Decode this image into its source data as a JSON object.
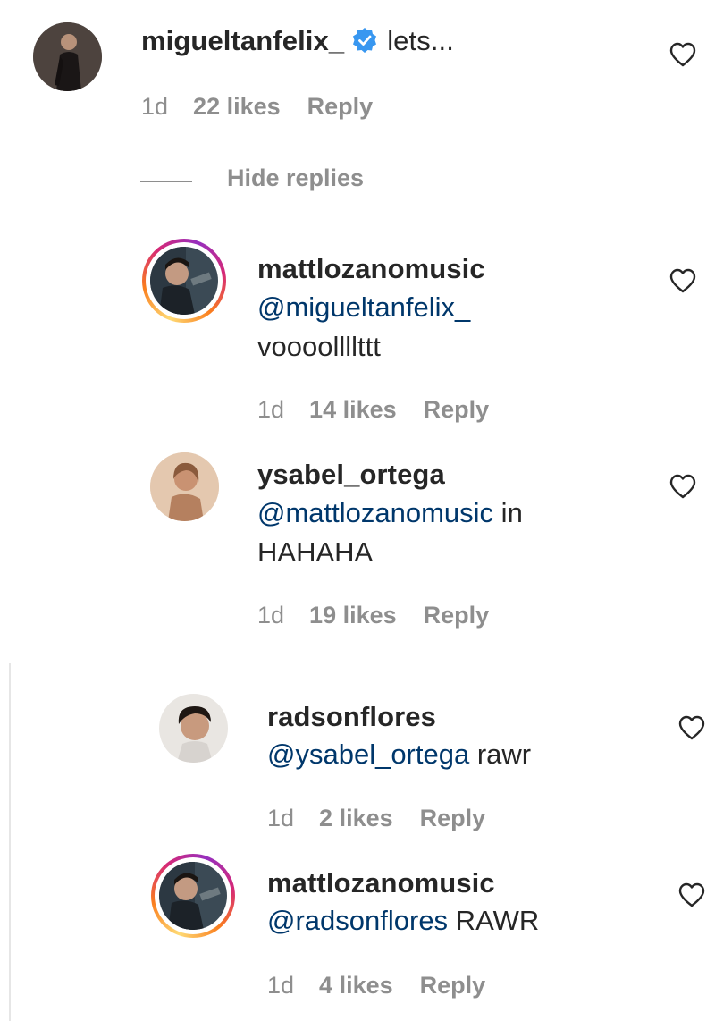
{
  "top_comment": {
    "username": "migueltanfelix_",
    "text": "lets...",
    "time": "1d",
    "likes": "22 likes",
    "reply": "Reply"
  },
  "hide_replies": "Hide replies",
  "replies": [
    {
      "username": "mattlozanomusic",
      "mention": "@migueltanfelix_",
      "text": "voooollllttt",
      "time": "1d",
      "likes": "14 likes",
      "reply": "Reply"
    },
    {
      "username": "ysabel_ortega",
      "mention": "@mattlozanomusic",
      "text_inline": " in",
      "text": "HAHAHA",
      "time": "1d",
      "likes": "19 likes",
      "reply": "Reply"
    },
    {
      "username": "radsonflores",
      "mention": "@ysabel_ortega",
      "text_inline": " rawr",
      "time": "1d",
      "likes": "2 likes",
      "reply": "Reply"
    },
    {
      "username": "mattlozanomusic",
      "mention": "@radsonflores",
      "text_inline": " RAWR",
      "time": "1d",
      "likes": "4 likes",
      "reply": "Reply"
    }
  ],
  "colors": {
    "text": "#262626",
    "meta": "#8e8e8e",
    "mention": "#00376b",
    "verified": "#3897f0"
  },
  "icons": [
    "heart-icon",
    "verified-badge-icon"
  ]
}
